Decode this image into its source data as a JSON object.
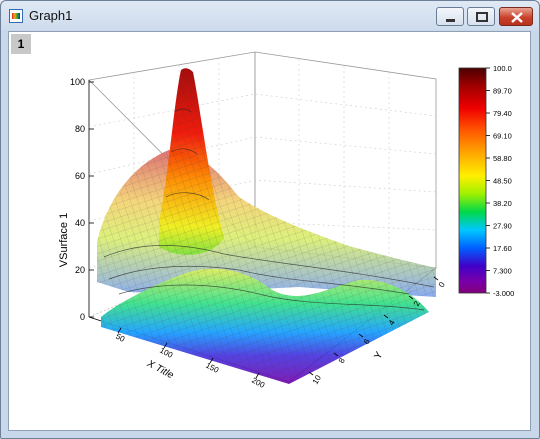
{
  "window": {
    "title": "Graph1"
  },
  "layer_tab": "1",
  "chart_data": {
    "type": "surface-3d",
    "zlabel": "VSurface 1",
    "xlabel": "X Title",
    "ylabel": "Y",
    "z_ticks": [
      "0",
      "20",
      "40",
      "60",
      "80",
      "100"
    ],
    "x_ticks": [
      "50",
      "100",
      "150",
      "200"
    ],
    "y_ticks": [
      "10",
      "8",
      "6",
      "4",
      "2",
      "0"
    ],
    "colorbar": {
      "labels": [
        "100.0",
        "89.70",
        "79.40",
        "69.10",
        "58.80",
        "48.50",
        "38.20",
        "27.90",
        "17.60",
        "7.300",
        "-3.000"
      ],
      "colors": [
        "#4a0000",
        "#a00000",
        "#f00000",
        "#ff5a00",
        "#ffa800",
        "#fff000",
        "#9ef000",
        "#00d84a",
        "#00c8ff",
        "#0060ff",
        "#4000c8",
        "#7a00a8",
        "#80007a"
      ]
    }
  }
}
